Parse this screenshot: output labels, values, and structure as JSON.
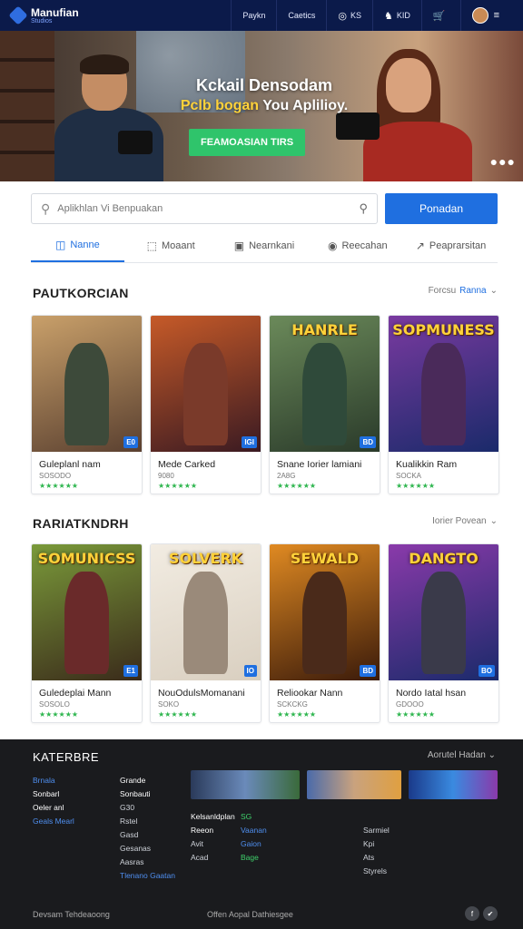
{
  "header": {
    "logo_title": "Manufian",
    "logo_sub": "Studios",
    "nav": [
      {
        "label": "Paykn",
        "icon": ""
      },
      {
        "label": "Caetics",
        "icon": ""
      },
      {
        "label": "KS",
        "icon": "◎"
      },
      {
        "label": "KID",
        "icon": "♞"
      },
      {
        "label": "",
        "icon": "🛒"
      }
    ],
    "menu_icon": "≡"
  },
  "hero": {
    "title": "Kckail Densodam",
    "sub_yellow": "Pclb bogan",
    "sub_white": "You Aplilioy.",
    "cta": "FEAMOASIAN TIRS",
    "dots": "●●●"
  },
  "search": {
    "placeholder": "Aplikhlan Vi Benpuakan",
    "button": "Ponadan"
  },
  "tabs": [
    {
      "label": "Nanne",
      "icon": "◫",
      "active": true
    },
    {
      "label": "Moaant",
      "icon": "⬚",
      "active": false
    },
    {
      "label": "Nearnkani",
      "icon": "▣",
      "active": false
    },
    {
      "label": "Reecahan",
      "icon": "◉",
      "active": false
    },
    {
      "label": "Peaprarsitan",
      "icon": "↗",
      "active": false
    }
  ],
  "section1": {
    "title": "PAUTKORCIAN",
    "more_label": "Forcsu",
    "more_accent": "Ranna",
    "cards": [
      {
        "name": "Guleplanl nam",
        "meta": "SOSODO",
        "badge": "E0",
        "art_label": "",
        "bg": [
          "#c9a06a",
          "#5a4030"
        ],
        "fig": "#3d4a3a"
      },
      {
        "name": "Mede Carked",
        "meta": "9080",
        "badge": "IGI",
        "art_label": "",
        "bg": [
          "#c65a28",
          "#3a1a22"
        ],
        "fig": "#7a3a2a"
      },
      {
        "name": "Snane Iorier lamiani",
        "meta": "2A8G",
        "badge": "BD",
        "art_label": "HANRLE",
        "bg": [
          "#6b8a5a",
          "#2a3a2a"
        ],
        "fig": "#2f4a3a"
      },
      {
        "name": "Kualikkin Ram",
        "meta": "SOCKA",
        "badge": "",
        "art_label": "SOPMUNESS",
        "bg": [
          "#7a3aa0",
          "#1a2a6a"
        ],
        "fig": "#4a2a5a"
      }
    ]
  },
  "section2": {
    "title": "RARIATKNDRH",
    "more_label": "Iorier Povean",
    "cards": [
      {
        "name": "Guledeplai Mann",
        "meta": "SOSOLO",
        "badge": "E1",
        "art_label": "SOMUNICSS",
        "bg": [
          "#7a9a3a",
          "#3a2a1a"
        ],
        "fig": "#6a2a2a"
      },
      {
        "name": "NouOdulsMomanani",
        "meta": "SOKO",
        "badge": "IO",
        "art_label": "SOLVERK",
        "bg": [
          "#f2ece2",
          "#d9cfc0"
        ],
        "fig": "#9a8a7a"
      },
      {
        "name": "Reliookar Nann",
        "meta": "SCKCKG",
        "badge": "BD",
        "art_label": "SEWALD",
        "bg": [
          "#e08a22",
          "#3a1a0a"
        ],
        "fig": "#4a2a1a"
      },
      {
        "name": "Nordo Iatal hsan",
        "meta": "GDOOO",
        "badge": "BO",
        "art_label": "DANGTO",
        "bg": [
          "#8a3aaa",
          "#1a2a6a"
        ],
        "fig": "#3a3a4a"
      }
    ]
  },
  "stars": "★★★★★★",
  "footer": {
    "title": "KATERBRE",
    "more": "Aorutel Hadan",
    "col1": [
      {
        "text": "Brnala",
        "style": "link"
      },
      {
        "text": "Sonbarl",
        "style": "hi"
      },
      {
        "text": "Oeler anl",
        "style": "hi"
      },
      {
        "text": "Geals Mearl",
        "style": "link"
      }
    ],
    "col2": [
      {
        "text": "Grande",
        "style": "hi"
      },
      {
        "text": "Sonbauti",
        "style": "hi"
      },
      {
        "text": "G30",
        "style": ""
      },
      {
        "text": "Rstel",
        "style": ""
      },
      {
        "text": "Gasd",
        "style": ""
      },
      {
        "text": "Gesanas",
        "style": ""
      },
      {
        "text": "Aasras",
        "style": ""
      },
      {
        "text": "Tlenano Gaatan",
        "style": "link"
      }
    ],
    "col3": [
      {
        "text": "Kelsanldplan",
        "style": "hi"
      },
      {
        "text": "Reeon",
        "style": "hi"
      },
      {
        "text": "Avit",
        "style": ""
      },
      {
        "text": "Acad",
        "style": ""
      }
    ],
    "col4": [
      {
        "text": "",
        "style": ""
      },
      {
        "text": "SG",
        "style": "green"
      },
      {
        "text": "Vaanan",
        "style": "link"
      },
      {
        "text": "Gaion",
        "style": "link"
      },
      {
        "text": "Bage",
        "style": "green"
      }
    ],
    "col5": [
      {
        "text": "Sarmiel",
        "style": ""
      },
      {
        "text": "Kpi",
        "style": ""
      },
      {
        "text": "Ats",
        "style": ""
      },
      {
        "text": "Styrels",
        "style": ""
      }
    ],
    "bottom_left": "Devsam Tehdeaoong",
    "bottom_mid": "Offen Aopal Dathiesgee",
    "social": [
      "f",
      "✔"
    ]
  }
}
